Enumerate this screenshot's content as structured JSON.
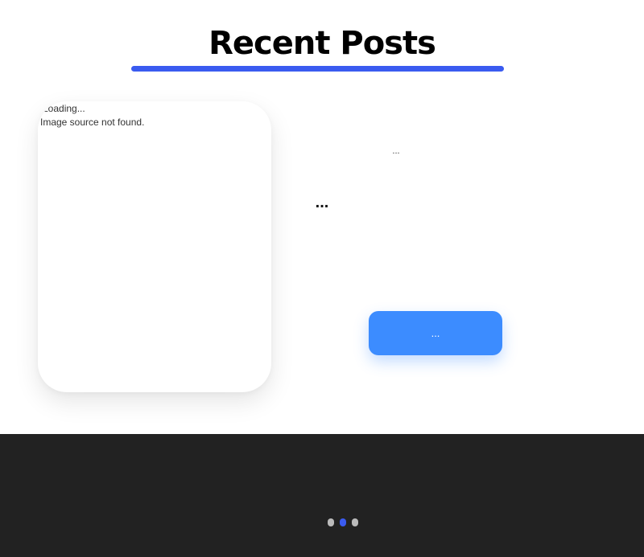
{
  "section": {
    "title": "Recent Posts",
    "accent_color": "#3a5bf0"
  },
  "card": {
    "loading_text": "Loading...",
    "missing_text": "Image source not found."
  },
  "post": {
    "meta": "...",
    "title": "...",
    "button_label": "...",
    "button_color": "#3c8cff"
  },
  "footer": {
    "background": "#222222",
    "carousel": {
      "active_index": 1,
      "dots": [
        {
          "color": "#bbbbbb"
        },
        {
          "color": "#3a5bf0"
        },
        {
          "color": "#bbbbbb"
        }
      ]
    }
  }
}
